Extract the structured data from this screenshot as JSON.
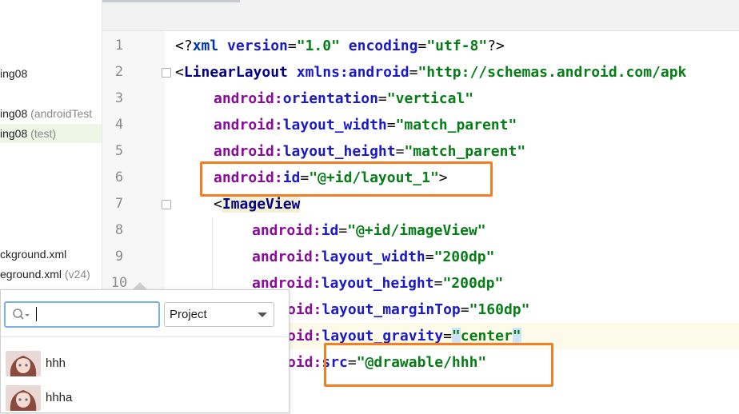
{
  "project_tree": {
    "rows": [
      {
        "text": "ing08",
        "suffix": ""
      },
      {
        "text": "ing08",
        "suffix": " (androidTest"
      },
      {
        "text": "ing08",
        "suffix": " (test)"
      },
      {
        "text": "ckground.xml",
        "suffix": ""
      },
      {
        "text": "eground.xml",
        "suffix": " (v24)"
      }
    ]
  },
  "editor": {
    "line_numbers": [
      "1",
      "2",
      "3",
      "4",
      "5",
      "6",
      "7",
      "8",
      "9",
      "10"
    ],
    "code": {
      "l1_open": "<?",
      "l1_xml": "xml",
      "l1_ver_attr": " version",
      "l1_eq1": "=",
      "l1_ver_val": "\"1.0\"",
      "l1_enc_attr": " encoding",
      "l1_eq2": "=",
      "l1_enc_val": "\"utf-8\"",
      "l1_close": "?>",
      "l2_lt": "<",
      "l2_tag": "LinearLayout",
      "l2_ns": " xmlns:android",
      "l2_eq": "=",
      "l2_val": "\"http://schemas.android.com/apk",
      "l3_ns": "android:",
      "l3_attr": "orientation",
      "l3_eq": "=",
      "l3_val": "\"vertical\"",
      "l4_ns": "android:",
      "l4_attr": "layout_width",
      "l4_eq": "=",
      "l4_val": "\"match_parent\"",
      "l5_ns": "android:",
      "l5_attr": "layout_height",
      "l5_eq": "=",
      "l5_val": "\"match_parent\"",
      "l6_ns": "android:",
      "l6_attr": "id",
      "l6_eq": "=",
      "l6_val": "\"@+id/layout_1\"",
      "l6_gt": ">",
      "l7_lt": "<",
      "l7_tag": "ImageView",
      "l8_ns": "android:",
      "l8_attr": "id",
      "l8_eq": "=",
      "l8_val": "\"@+id/imageView\"",
      "l9_ns": "android:",
      "l9_attr": "layout_width",
      "l9_eq": "=",
      "l9_val": "\"200dp\"",
      "l10_ns": "android:",
      "l10_attr": "layout_height",
      "l10_eq": "=",
      "l10_val": "\"200dp\"",
      "l11_ns": "oid:",
      "l11_attr": "layout_marginTop",
      "l11_eq": "=",
      "l11_val": "\"160dp\"",
      "l12_ns": "oid:",
      "l12_attr": "layout_gravity",
      "l12_eq": "=",
      "l12_q1": "\"",
      "l12_val": "center",
      "l12_q2": "\"",
      "l13_ns": "oid:",
      "l13_attr": "src",
      "l13_eq": "=",
      "l13_val": "\"@drawable/hhh\"",
      "l14_partial": ". ."
    }
  },
  "popup": {
    "search_value": "",
    "scope_selected": "Project",
    "results": [
      {
        "label": "hhh"
      },
      {
        "label": "hhha"
      }
    ]
  },
  "colors": {
    "highlight_box": "#f57e25",
    "search_focus": "#7ab1e6"
  }
}
